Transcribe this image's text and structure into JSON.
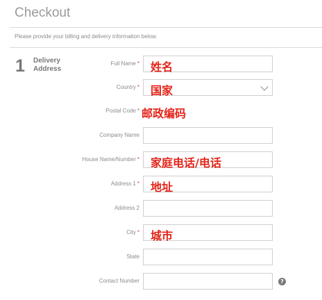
{
  "page": {
    "title": "Checkout",
    "subtitle": "Please provide your billing and delivery information below."
  },
  "section": {
    "number": "1",
    "label_line1": "Delivery",
    "label_line2": "Address"
  },
  "form": {
    "required_mark": "*",
    "fields": [
      {
        "label": "Full Name",
        "required": true,
        "value": "姓名",
        "type": "text"
      },
      {
        "label": "Country",
        "required": true,
        "value": "国家",
        "type": "select"
      },
      {
        "label": "Postal Code",
        "required": true,
        "value": "邮政编码",
        "type": "text-overlay"
      },
      {
        "label": "Company Name",
        "required": false,
        "value": "",
        "type": "text"
      },
      {
        "label": "House Name/Number",
        "required": true,
        "value": "家庭电话/电话",
        "type": "text"
      },
      {
        "label": "Address 1",
        "required": true,
        "value": "地址",
        "type": "text"
      },
      {
        "label": "Address 2",
        "required": false,
        "value": "",
        "type": "text"
      },
      {
        "label": "City",
        "required": true,
        "value": "城市",
        "type": "text"
      },
      {
        "label": "State",
        "required": false,
        "value": "",
        "type": "text"
      },
      {
        "label": "Contact Number",
        "required": false,
        "value": "",
        "type": "text",
        "help": true
      }
    ]
  },
  "help_icon_glyph": "?",
  "colors": {
    "overlay_red": "#e32419",
    "required_red": "#d94a4a"
  },
  "icons": {
    "country_dropdown": "chevron-down-icon",
    "contact_help": "question-icon"
  }
}
